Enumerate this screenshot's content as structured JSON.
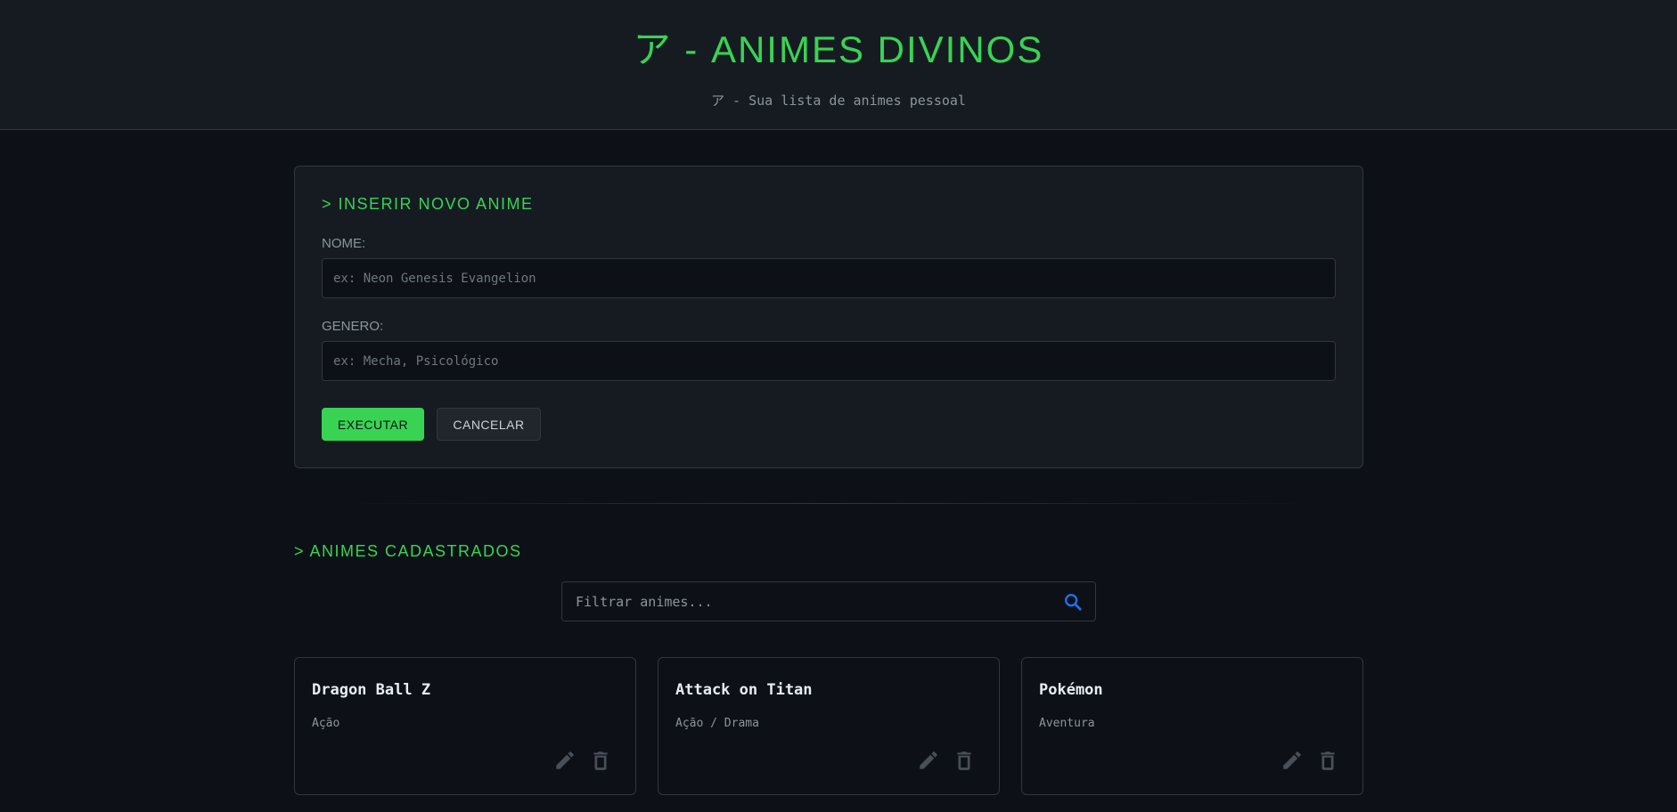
{
  "header": {
    "title": "ア - ANIMES DIVINOS",
    "subtitle": "ア - Sua lista de animes pessoal"
  },
  "form": {
    "heading": "> INSERIR NOVO ANIME",
    "name_label": "NOME:",
    "name_placeholder": "ex: Neon Genesis Evangelion",
    "genre_label": "GENERO:",
    "genre_placeholder": "ex: Mecha, Psicológico",
    "execute_label": "EXECUTAR",
    "cancel_label": "CANCELAR"
  },
  "list": {
    "heading": "> ANIMES CADASTRADOS",
    "filter_placeholder": "Filtrar animes...",
    "cards": [
      {
        "title": "Dragon Ball Z",
        "genre": "Ação"
      },
      {
        "title": "Attack on Titan",
        "genre": "Ação / Drama"
      },
      {
        "title": "Pokémon",
        "genre": "Aventura"
      }
    ]
  },
  "colors": {
    "accent": "#39d353",
    "background": "#0d1117",
    "panel": "#161b22",
    "border": "#30363d",
    "muted_text": "#8b949e",
    "search_icon": "#1f6feb",
    "action_icon": "#484f58"
  },
  "icons": {
    "search": "search-icon",
    "edit": "pencil-icon",
    "delete": "trash-icon"
  }
}
